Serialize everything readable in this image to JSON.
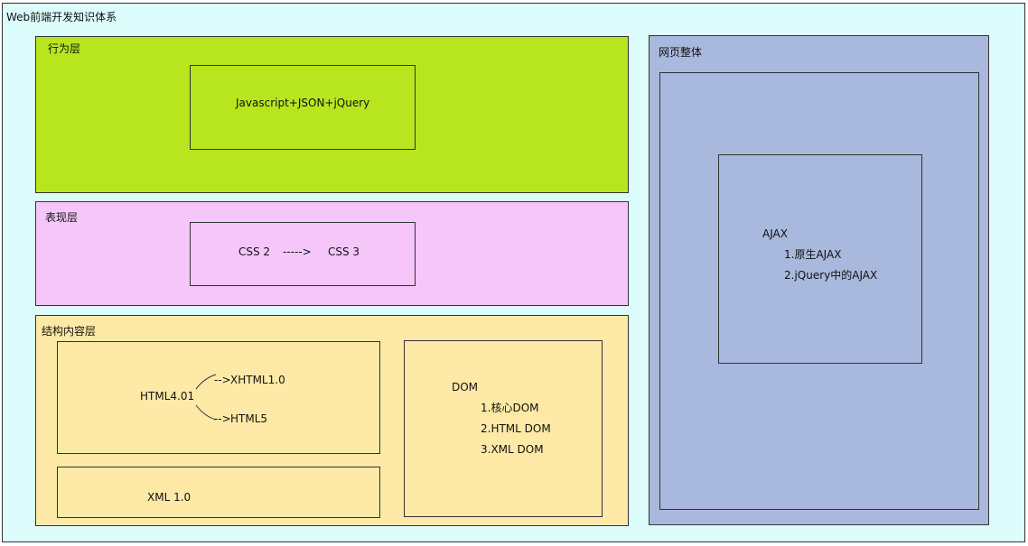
{
  "diagram": {
    "title": "Web前端开发知识体系",
    "behavior_layer": {
      "label": "行为层",
      "content": "Javascript+JSON+jQuery"
    },
    "presentation_layer": {
      "label": "表现层",
      "from": "CSS 2",
      "arrow": "----->",
      "to": "CSS 3"
    },
    "structure_layer": {
      "label": "结构内容层",
      "html": {
        "source": "HTML4.01",
        "targets": [
          "XHTML1.0",
          "HTML5"
        ],
        "arrow_prefix": "-->"
      },
      "xml": "XML 1.0",
      "dom": {
        "title": "DOM",
        "items": [
          "1.核心DOM",
          "2.HTML DOM",
          "3.XML DOM"
        ]
      }
    },
    "page_whole": {
      "label": "网页整体",
      "ajax": {
        "title": "AJAX",
        "items": [
          "1.原生AJAX",
          "2.jQuery中的AJAX"
        ]
      }
    }
  }
}
